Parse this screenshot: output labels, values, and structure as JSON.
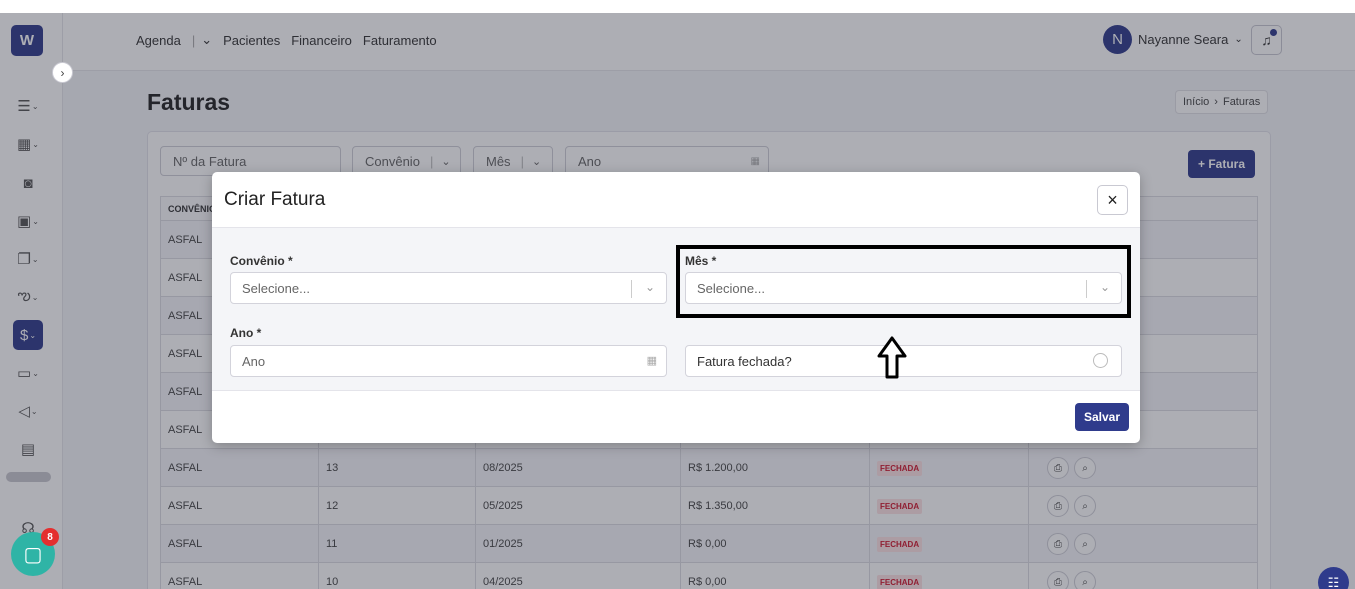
{
  "sidebar": {
    "logo": "W",
    "badge_count": "8"
  },
  "topnav": {
    "items": [
      "Agenda",
      "Pacientes",
      "Financeiro",
      "Faturamento"
    ],
    "user_initial": "N",
    "user_name": "Nayanne Seara"
  },
  "page": {
    "title": "Faturas",
    "breadcrumb": [
      "Início",
      "Faturas"
    ],
    "filters": {
      "invoice_placeholder": "Nº da Fatura",
      "convenio": "Convênio",
      "mes": "Mês",
      "ano_placeholder": "Ano"
    },
    "add_button": "+ Fatura"
  },
  "table": {
    "header_first": "CONVÊNIO",
    "rows": [
      {
        "convenio": "ASFAL",
        "numero": "",
        "mes": "",
        "valor": "",
        "status": ""
      },
      {
        "convenio": "ASFAL",
        "numero": "",
        "mes": "",
        "valor": "",
        "status": ""
      },
      {
        "convenio": "ASFAL",
        "numero": "",
        "mes": "",
        "valor": "",
        "status": ""
      },
      {
        "convenio": "ASFAL",
        "numero": "",
        "mes": "",
        "valor": "",
        "status": ""
      },
      {
        "convenio": "ASFAL",
        "numero": "",
        "mes": "",
        "valor": "",
        "status": ""
      },
      {
        "convenio": "ASFAL",
        "numero": "",
        "mes": "",
        "valor": "",
        "status": ""
      },
      {
        "convenio": "ASFAL",
        "numero": "13",
        "mes": "08/2025",
        "valor": "R$ 1.200,00",
        "status": "FECHADA"
      },
      {
        "convenio": "ASFAL",
        "numero": "12",
        "mes": "05/2025",
        "valor": "R$ 1.350,00",
        "status": "FECHADA"
      },
      {
        "convenio": "ASFAL",
        "numero": "11",
        "mes": "01/2025",
        "valor": "R$ 0,00",
        "status": "FECHADA"
      },
      {
        "convenio": "ASFAL",
        "numero": "10",
        "mes": "04/2025",
        "valor": "R$ 0,00",
        "status": "FECHADA"
      }
    ]
  },
  "modal": {
    "title": "Criar Fatura",
    "close": "×",
    "convenio_label": "Convênio *",
    "convenio_placeholder": "Selecione...",
    "mes_label": "Mês *",
    "mes_placeholder": "Selecione...",
    "ano_label": "Ano *",
    "ano_placeholder": "Ano",
    "fechada_label": "Fatura fechada?",
    "save": "Salvar"
  },
  "colors": {
    "primary": "#2f3b8c",
    "closed_badge": "#d0182e",
    "chat": "#2fb4a6"
  }
}
